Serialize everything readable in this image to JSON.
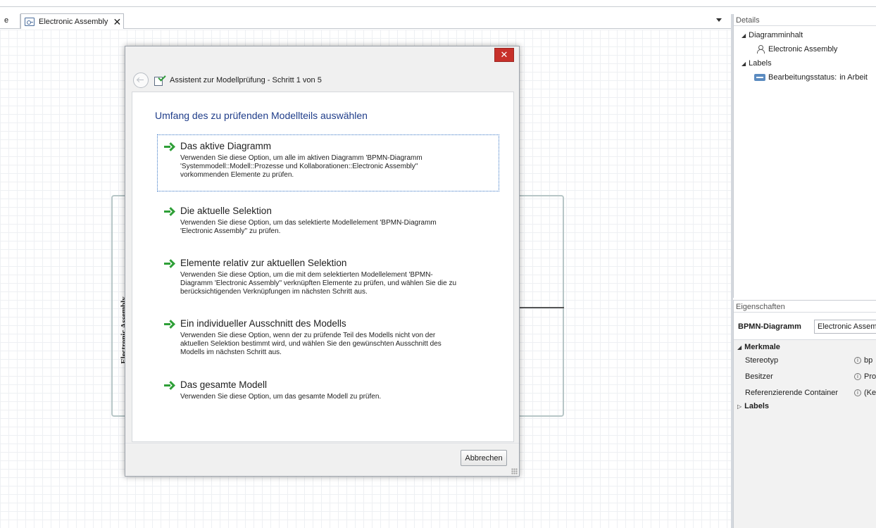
{
  "editor": {
    "partial_tab_label": "e",
    "active_tab": {
      "title": "Electronic Assembly",
      "close_glyph": "✕"
    },
    "dropdown_icon": "chevron-down-icon"
  },
  "canvas": {
    "pool_label": "Electronic Assembly"
  },
  "details": {
    "header": "Details",
    "tree": {
      "section1": {
        "label": "Diagramminhalt",
        "expanded": true
      },
      "section1_child": {
        "label": "Electronic Assembly",
        "icon": "participant-icon"
      },
      "section2": {
        "label": "Labels",
        "expanded": true
      },
      "section2_child": {
        "label": "Bearbeitungsstatus:",
        "value": "in Arbeit",
        "icon": "label-icon"
      }
    }
  },
  "properties": {
    "header": "Eigenschaften",
    "type_label": "BPMN-Diagramm",
    "name_value": "Electronic Assemb",
    "section_merkmale": "Merkmale",
    "rows": [
      {
        "name": "Stereotyp",
        "value": "bp"
      },
      {
        "name": "Besitzer",
        "value": "Pro"
      },
      {
        "name": "Referenzierende Container",
        "value": "(Ke"
      }
    ],
    "section_labels": "Labels"
  },
  "wizard": {
    "close_glyph": "✕",
    "title": "Assistent zur Modellprüfung - Schritt 1 von 5",
    "heading": "Umfang des zu prüfenden Modellteils auswählen",
    "options": [
      {
        "title": "Das aktive Diagramm",
        "lines": [
          "Verwenden Sie diese Option, um alle im aktiven Diagramm 'BPMN-Diagramm",
          "'Systemmodell::Modell::Prozesse und Kollaborationen::Electronic Assembly''",
          "vorkommenden Elemente zu prüfen."
        ]
      },
      {
        "title": "Die aktuelle Selektion",
        "lines": [
          "Verwenden Sie diese Option, um das selektierte Modellelement 'BPMN-Diagramm",
          "'Electronic Assembly'' zu prüfen."
        ]
      },
      {
        "title": "Elemente relativ zur aktuellen Selektion",
        "lines": [
          "Verwenden Sie diese Option, um die mit dem selektierten Modellelement 'BPMN-",
          "Diagramm 'Electronic Assembly'' verknüpften Elemente zu prüfen, und wählen Sie die zu",
          "berücksichtigenden Verknüpfungen im nächsten Schritt aus."
        ]
      },
      {
        "title": "Ein individueller Ausschnitt des Modells",
        "lines": [
          "Verwenden Sie diese Option, wenn der zu prüfende Teil des Modells nicht von der",
          "aktuellen Selektion bestimmt wird, und wählen Sie den gewünschten Ausschnitt des",
          "Modells im nächsten Schritt aus."
        ]
      },
      {
        "title": "Das gesamte Modell",
        "lines": [
          "Verwenden Sie diese Option, um das gesamte Modell zu prüfen."
        ]
      }
    ],
    "cancel_label": "Abbrechen"
  }
}
